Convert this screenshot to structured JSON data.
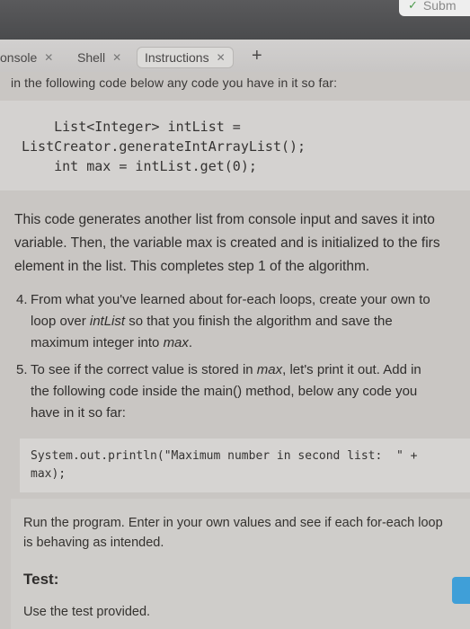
{
  "toolbar": {
    "submit_label": "Subm"
  },
  "tabs": [
    {
      "label": "onsole",
      "active": false
    },
    {
      "label": "Shell",
      "active": false
    },
    {
      "label": "Instructions",
      "active": true
    }
  ],
  "intro": "in the following code below any code you have in it so far:",
  "code_block_1": [
    "    List<Integer> intList =",
    "ListCreator.generateIntArrayList();",
    "    int max = intList.get(0);"
  ],
  "paragraph": {
    "line1": "This code generates another list from console input and saves it into",
    "line2": "variable. Then, the variable max is created and is initialized to the firs",
    "line3": "element in the list. This completes step 1 of the algorithm."
  },
  "step4": {
    "number": "4.",
    "line1": "From what you've learned about for-each loops, create your own to",
    "line2_a": "loop over ",
    "line2_em": "intList",
    "line2_b": " so that you finish the algorithm and save the",
    "line3_a": "maximum integer into ",
    "line3_em": "max",
    "line3_b": "."
  },
  "step5": {
    "number": "5.",
    "line1_a": "To see if the correct value is stored in ",
    "line1_em": "max",
    "line1_b": ", let's print it out. Add in",
    "line2": "the following code inside the main() method, below any code you",
    "line3": "have in it so far:"
  },
  "code_block_2": [
    "System.out.println(\"Maximum number in second list:  \" +",
    "max);"
  ],
  "run_text": "Run the program. Enter in your own values and see if each for-each loop is behaving as intended.",
  "test": {
    "heading": "Test:",
    "text": "Use the test provided."
  },
  "colors": {
    "accent": "#3f9fd8",
    "check": "#4c9a4c"
  }
}
